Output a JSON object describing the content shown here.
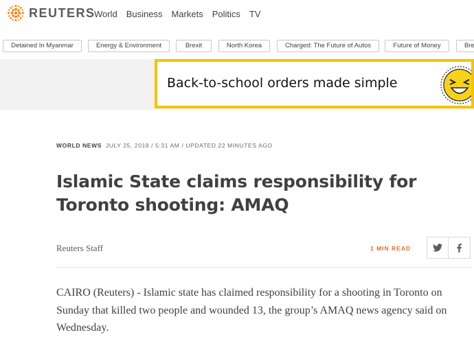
{
  "brand": {
    "name": "REUTERS",
    "accent": "#ff8000"
  },
  "nav": {
    "items": [
      "World",
      "Business",
      "Markets",
      "Politics",
      "TV"
    ]
  },
  "topics": [
    "Detained In Myanmar",
    "Energy & Environment",
    "Brexit",
    "North Korea",
    "Charged: The Future of Autos",
    "Future of Money",
    "Bre"
  ],
  "ad": {
    "text": "Back-to-school orders made simple",
    "border_color": "#f4c400"
  },
  "article": {
    "category": "WORLD NEWS",
    "dateline": "JULY 25, 2018 / 5:31 AM / UPDATED 22 MINUTES AGO",
    "headline": "Islamic State claims responsibility for Toronto shooting: AMAQ",
    "byline": "Reuters Staff",
    "read_time": "1 MIN READ",
    "share_icons": [
      "twitter-icon",
      "facebook-icon"
    ],
    "body": "CAIRO (Reuters) - Islamic state has claimed responsibility for a shooting in Toronto on Sunday that killed two people and wounded 13, the group’s AMAQ news agency said on Wednesday."
  }
}
